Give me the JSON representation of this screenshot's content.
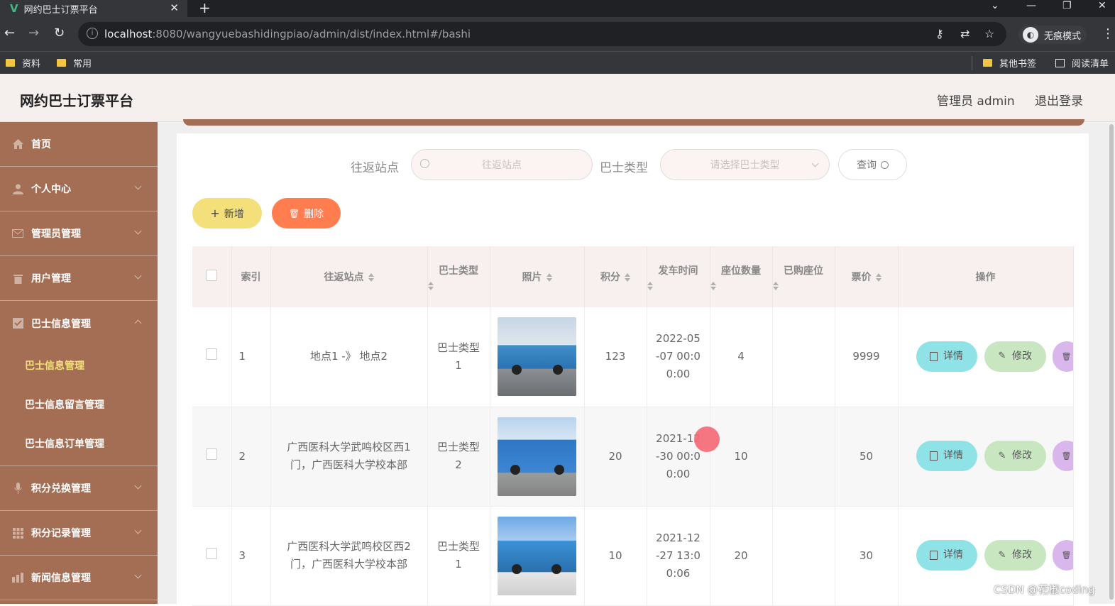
{
  "browser": {
    "tab_title": "网约巴士订票平台",
    "url_host": "localhost",
    "url_path": ":8080/wangyuebashidingpiao/admin/dist/index.html#/bashi",
    "incognito_label": "无痕模式",
    "bookmarks": [
      "资料",
      "常用"
    ],
    "bookmarks_right": [
      "其他书签",
      "阅读清单"
    ]
  },
  "header": {
    "brand": "网约巴士订票平台",
    "user_label": "管理员 admin",
    "logout": "退出登录"
  },
  "sidebar": {
    "items": [
      {
        "label": "首页",
        "icon": "home-icon"
      },
      {
        "label": "个人中心",
        "icon": "user-icon"
      },
      {
        "label": "管理员管理",
        "icon": "mail-icon"
      },
      {
        "label": "用户管理",
        "icon": "trash-icon"
      },
      {
        "label": "巴士信息管理",
        "icon": "check-icon"
      },
      {
        "label": "积分兑换管理",
        "icon": "mic-icon"
      },
      {
        "label": "积分记录管理",
        "icon": "grid-icon"
      },
      {
        "label": "新闻信息管理",
        "icon": "chart-icon"
      }
    ],
    "subitems": [
      "巴士信息管理",
      "巴士信息留言管理",
      "巴士信息订单管理"
    ]
  },
  "search": {
    "station_label": "往返站点",
    "station_placeholder": "往返站点",
    "type_label": "巴士类型",
    "type_placeholder": "请选择巴士类型",
    "query_button": "查询"
  },
  "actions": {
    "add": "新增",
    "delete": "删除"
  },
  "table": {
    "headers": [
      "索引",
      "往返站点",
      "巴士类型",
      "照片",
      "积分",
      "发车时间",
      "座位数量",
      "已购座位",
      "票价",
      "操作"
    ],
    "rows": [
      {
        "index": "1",
        "station_1": "地点1 -》 地点2",
        "station_2": "",
        "type_1": "巴士类型",
        "type_2": "1",
        "points": "123",
        "time_1": "2022-05",
        "time_2": "-07 00:0",
        "time_3": "0:00",
        "seats": "4",
        "bought": "",
        "price": "9999"
      },
      {
        "index": "2",
        "station_1": "广西医科大学武鸣校区西1",
        "station_2": "门，广西医科大学校本部",
        "type_1": "巴士类型",
        "type_2": "2",
        "points": "20",
        "time_1": "2021-12",
        "time_2": "-30 00:0",
        "time_3": "0:00",
        "seats": "10",
        "bought": "",
        "price": "50"
      },
      {
        "index": "3",
        "station_1": "广西医科大学武鸣校区西2",
        "station_2": "门，广西医科大学校本部",
        "type_1": "巴士类型",
        "type_2": "1",
        "points": "10",
        "time_1": "2021-12",
        "time_2": "-27 13:0",
        "time_3": "0:06",
        "seats": "20",
        "bought": "",
        "price": "30"
      }
    ],
    "detail_label": "详情",
    "edit_label": "修改"
  },
  "watermark": "CSDN @花椒coding",
  "colors": {
    "sidebar": "#a46e55",
    "active_sub": "#f5e27a",
    "add_button": "#f3e07a",
    "delete_button": "#ff7d4f",
    "detail_button": "#8fe3e6",
    "edit_button": "#c8e6c0"
  }
}
